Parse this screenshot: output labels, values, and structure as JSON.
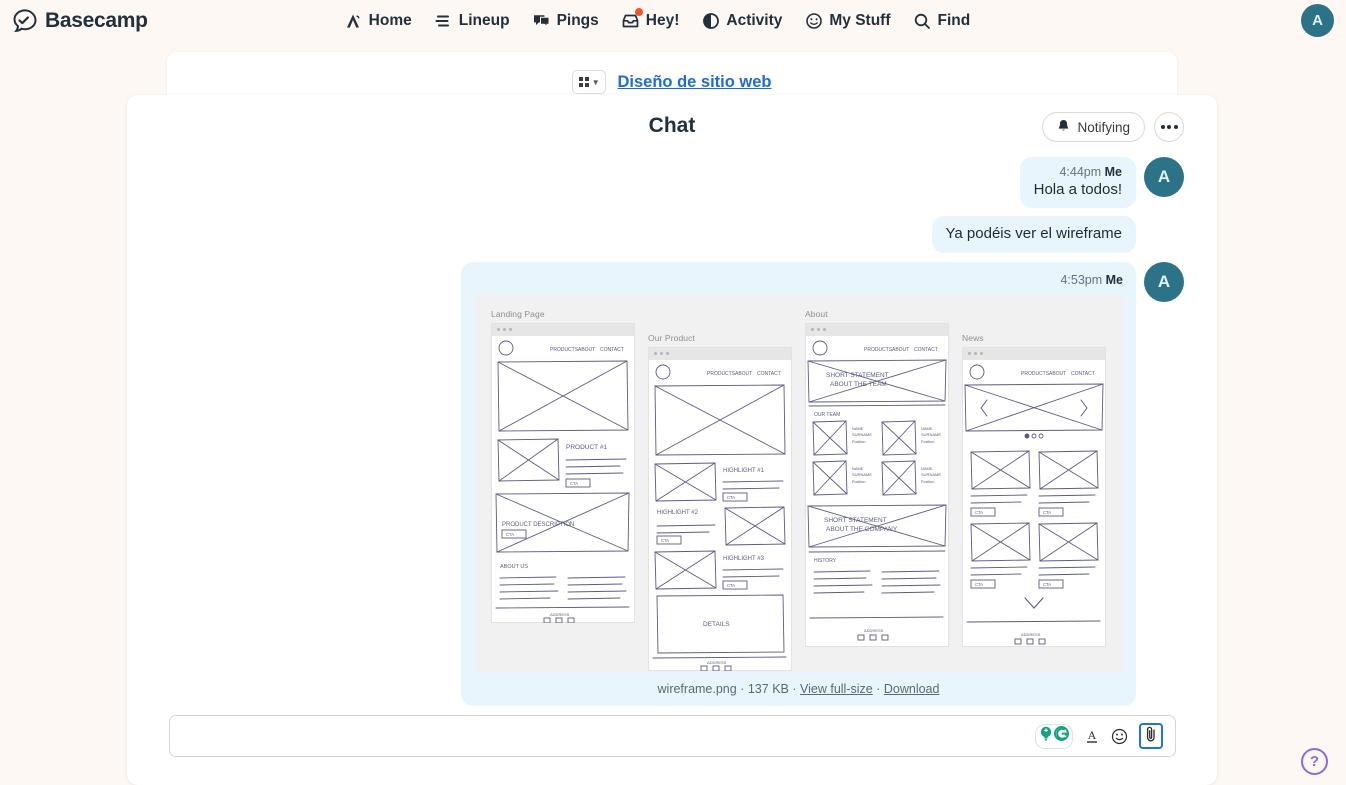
{
  "brand": {
    "name": "Basecamp",
    "logo_icon": "basecamp-logo-icon",
    "accent_blue": "#1f6bd8",
    "avatar_teal": "#2d7387",
    "badge_red": "#f4532b",
    "bubble_blue": "#e9f5fd",
    "page_bg": "#fdf8f4"
  },
  "nav": {
    "items": [
      {
        "label": "Home",
        "icon": "home-tent-icon",
        "badge": false
      },
      {
        "label": "Lineup",
        "icon": "lineup-bars-icon",
        "badge": false
      },
      {
        "label": "Pings",
        "icon": "pings-chat-icon",
        "badge": false
      },
      {
        "label": "Hey!",
        "icon": "hey-inbox-icon",
        "badge": true
      },
      {
        "label": "Activity",
        "icon": "activity-half-circle-icon",
        "badge": false
      },
      {
        "label": "My Stuff",
        "icon": "my-stuff-smiley-icon",
        "badge": false
      },
      {
        "label": "Find",
        "icon": "find-search-icon",
        "badge": false
      }
    ],
    "account_avatar_initial": "A"
  },
  "breadcrumb": {
    "grid_icon": "grid-menu-icon",
    "chevron_icon": "chevron-down-icon",
    "project_link": "Diseño de sitio web"
  },
  "chat": {
    "title": "Chat",
    "notify_button": {
      "label": "Notifying",
      "icon": "bell-icon"
    },
    "more_button": {
      "icon": "ellipsis-icon"
    },
    "messages": [
      {
        "time": "4:44pm",
        "author": "Me",
        "texts": [
          "Hola a todos!"
        ],
        "avatar_initial": "A",
        "show_avatar": true,
        "type": "text"
      },
      {
        "time": "",
        "author": "",
        "texts": [
          "Ya podéis ver el wireframe"
        ],
        "avatar_initial": "A",
        "show_avatar": false,
        "type": "text"
      },
      {
        "time": "4:53pm",
        "author": "Me",
        "avatar_initial": "A",
        "show_avatar": true,
        "type": "attachment",
        "attachment": {
          "filename": "wireframe.png",
          "filesize": "137 KB",
          "separator": "·",
          "view_link": "View full-size",
          "download_link": "Download"
        }
      }
    ]
  },
  "wireframe": {
    "panels": [
      {
        "label": "Landing Page",
        "nav_links": [
          "PRODUCTS",
          "ABOUT",
          "CONTACT"
        ],
        "sections": [
          "PRODUCT #1",
          "PRODUCT DESCRIPTION",
          "ABOUT US"
        ],
        "ctas": [
          "CTA",
          "CTA"
        ],
        "footer": "ADDRESS"
      },
      {
        "label": "Our Product",
        "nav_links": [
          "PRODUCTS",
          "ABOUT",
          "CONTACT"
        ],
        "sections": [
          "HIGHLIGHT #1",
          "HIGHLIGHT #2",
          "HIGHLIGHT #3",
          "DETAILS"
        ],
        "ctas": [
          "CTA",
          "CTA",
          "CTA"
        ],
        "footer": "ADDRESS"
      },
      {
        "label": "About",
        "nav_links": [
          "PRODUCTS",
          "ABOUT",
          "CONTACT"
        ],
        "sections": [
          "SHORT STATEMENT ABOUT THE TEAM",
          "OUR TEAM",
          "SHORT STATEMENT ABOUT THE COMPANY",
          "HISTORY"
        ],
        "card_labels": [
          "NAME SURNAME",
          "Position"
        ],
        "footer": "ADDRESS"
      },
      {
        "label": "News",
        "nav_links": [
          "PRODUCTS",
          "ABOUT",
          "CONTACT"
        ],
        "sections": [],
        "ctas": [
          "CTA",
          "CTA",
          "CTA",
          "CTA"
        ],
        "footer": "ADDRESS"
      }
    ]
  },
  "composer": {
    "value": "",
    "placeholder": "",
    "tools": [
      {
        "name": "grammarly-badge",
        "icon": "grammarly-icon"
      },
      {
        "name": "text-format",
        "icon": "text-format-a-icon"
      },
      {
        "name": "emoji",
        "icon": "smiley-icon"
      },
      {
        "name": "attach",
        "icon": "paperclip-icon"
      }
    ]
  },
  "help": {
    "label": "?",
    "icon": "question-mark-icon"
  }
}
